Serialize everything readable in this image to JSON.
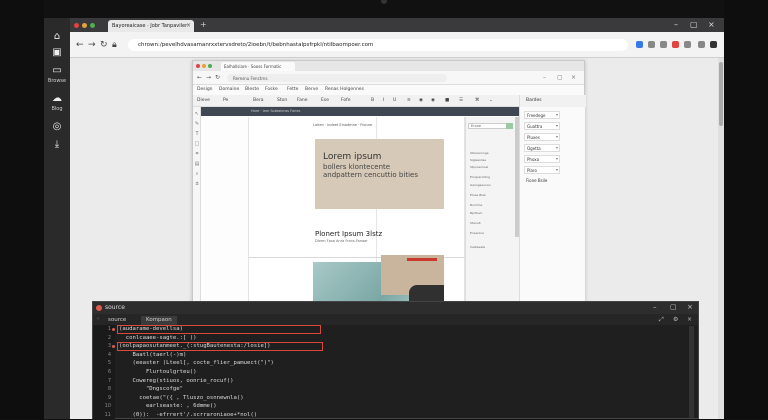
{
  "sidebar": {
    "items": [
      {
        "icon": "home-icon",
        "label": ""
      },
      {
        "icon": "grid-icon",
        "label": ""
      },
      {
        "icon": "layout-icon",
        "label": "Browse"
      },
      {
        "icon": "cloud-icon",
        "label": "Blog"
      },
      {
        "icon": "refresh-icon",
        "label": ""
      },
      {
        "icon": "download-icon",
        "label": ""
      }
    ]
  },
  "browser": {
    "tab_title": "Bayoreaicase · Jobr Tanpaviler",
    "url": "chrown:/pevelhdvasamanrxxtervsdreto/2ioebn/t/bebnhastalpsfrpkl/ntilbaompoer.com",
    "accent": "#3b78e7"
  },
  "inner": {
    "tab_title": "Ealhallsiare · Sooss Forrnatic",
    "url": "Reresnu Fenctrns",
    "menu": [
      "Design",
      "Domaine",
      "Bleste",
      "Foske",
      "Fette",
      "Berve",
      "Renas Holgennes"
    ],
    "toolbar": [
      "Dieve",
      "Pe",
      "Bera",
      "Ston",
      "Fane",
      "Ese",
      "Fofe"
    ],
    "ruler_label": "Hore · Iam Sobtaleras Fones",
    "page_label": "Laiten · Indeet Elnodmne · Fronne",
    "hero": {
      "title": "Lorem ipsum",
      "line1": "bollers klontecente",
      "line2": "andpattern cencuttio bities"
    },
    "section_title": "Plonert Ipsum  3lstz",
    "section_sub": "Dlorm Fpsa Anra Frans-Fanaar",
    "right_panel": {
      "search_value": "Erone",
      "lines": [
        "Olbereronge",
        "Sigleaolise",
        "Stpunerooel",
        "Ernsparolitng",
        "Gansgaeunen",
        "Eloee Bsal",
        "Borrrtoe",
        "Bprtlsvn",
        "Stanolt",
        "Eneenine",
        "Cestaeate"
      ]
    },
    "far_panel": {
      "header": "Bardes",
      "items": [
        "Freedege",
        "Guattra",
        "Pluxes",
        "Ogetta",
        "Phoxa",
        "Plaro",
        "Fione Bsile"
      ]
    }
  },
  "source": {
    "title": "source",
    "tabs": [
      "source",
      "Kompaon"
    ],
    "line_numbers": [
      "1",
      "2",
      "3",
      "4",
      "5",
      "6",
      "7",
      "8",
      "9",
      "10",
      "11"
    ],
    "lines": [
      "(audarame-devellsa)",
      "  conlcaaee-sagte.:[ ()",
      "(oolpapaosutanmeet._(:stugBautenesta:/losie])",
      "    Baatl(taerl(-)m)  ",
      "    (eeaster (Lteel[, cocte_flier_pamuect(\")\")",
      "        Flurtoulgrteu()",
      "    Cowereg(stiuos, oonrie_rocuf()",
      "        \"Dngscofge\"",
      "      coetae(\"({ , Tluszo_osnnewnla()",
      "        earlseaste: , 6dmme()",
      "    (0)):  -efrrert'/.scrraroniaoe+*nol()"
    ],
    "highlight_color": "#d9473e"
  }
}
